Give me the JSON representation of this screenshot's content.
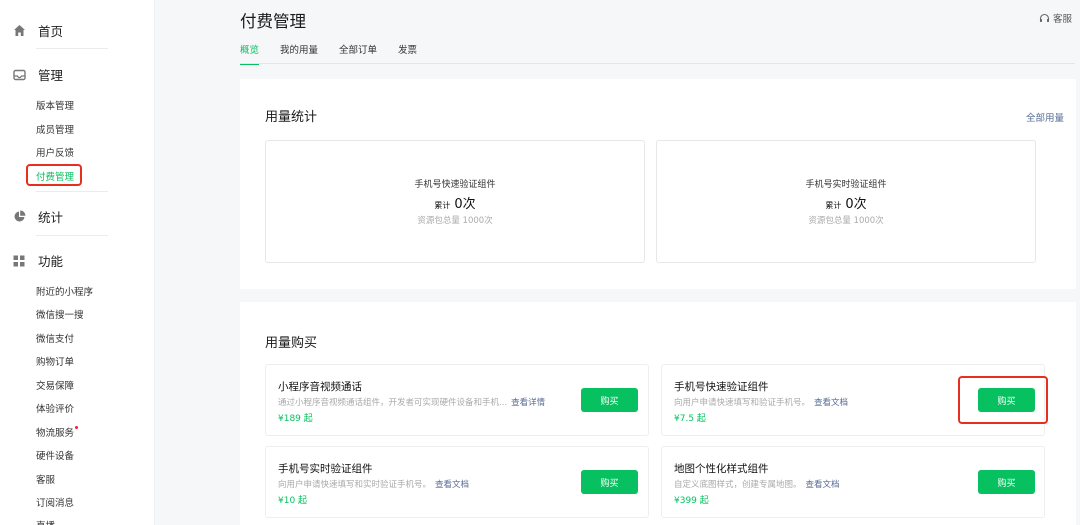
{
  "sidebar": {
    "home": "首页",
    "manage": {
      "label": "管理",
      "items": [
        "版本管理",
        "成员管理",
        "用户反馈",
        "付费管理"
      ]
    },
    "stats": "统计",
    "features": {
      "label": "功能",
      "items": [
        "附近的小程序",
        "微信搜一搜",
        "微信支付",
        "购物订单",
        "交易保障",
        "体验评价",
        "物流服务",
        "硬件设备",
        "客服",
        "订阅消息",
        "直播"
      ]
    }
  },
  "header": {
    "title": "付费管理",
    "service": "客服",
    "tabs": [
      "概览",
      "我的用量",
      "全部订单",
      "发票"
    ]
  },
  "usage": {
    "title": "用量统计",
    "all_link": "全部用量",
    "cards": [
      {
        "name": "手机号快速验证组件",
        "prefix": "累计",
        "count": "0次",
        "quota": "资源包总量 1000次"
      },
      {
        "name": "手机号实时验证组件",
        "prefix": "累计",
        "count": "0次",
        "quota": "资源包总量 1000次"
      }
    ]
  },
  "purchase": {
    "title": "用量购买",
    "products": [
      {
        "name": "小程序音视频通话",
        "desc": "通过小程序音视频通话组件，开发者可实现硬件设备和手机...",
        "link": "查看详情",
        "price": "¥189 起",
        "button": "购买"
      },
      {
        "name": "手机号快速验证组件",
        "desc": "向用户申请快速填写和验证手机号。",
        "link": "查看文档",
        "price": "¥7.5 起",
        "button": "购买"
      },
      {
        "name": "手机号实时验证组件",
        "desc": "向用户申请快速填写和实时验证手机号。",
        "link": "查看文档",
        "price": "¥10 起",
        "button": "购买"
      },
      {
        "name": "地图个性化样式组件",
        "desc": "自定义底图样式，创建专属地图。",
        "link": "查看文档",
        "price": "¥399 起",
        "button": "购买"
      }
    ]
  },
  "colors": {
    "accent": "#07c160",
    "link": "#576b95",
    "highlight": "#e6301f"
  }
}
